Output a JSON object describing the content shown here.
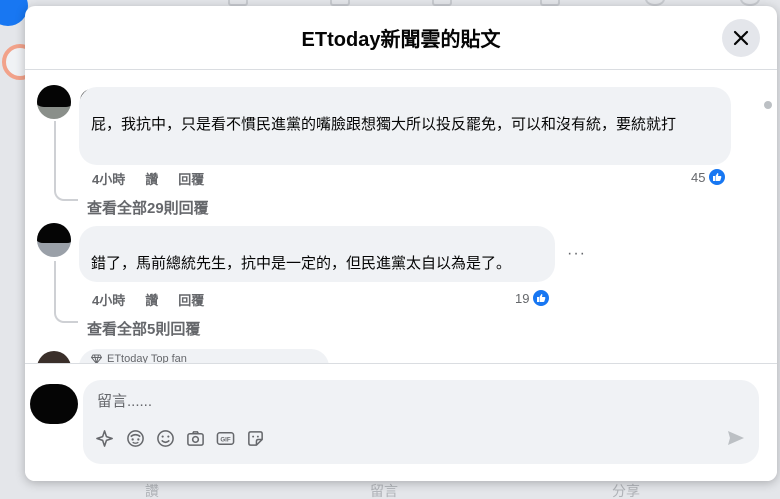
{
  "dialog": {
    "title": "ETtoday新聞雲的貼文",
    "close_label": "×"
  },
  "comments": [
    {
      "text": "屁，我抗中，只是看不慣民進黨的嘴臉跟想獨大所以投反罷免，可以和沒有統，要統就打",
      "time": "4小時",
      "like_action": "讚",
      "reply_action": "回覆",
      "reaction_count": "45",
      "view_replies": "查看全部29則回覆"
    },
    {
      "text": "錯了，馬前總統先生，抗中是一定的，但民進黨太自以為是了。",
      "time": "4小時",
      "like_action": "讚",
      "reply_action": "回覆",
      "reaction_count": "19",
      "view_replies": "查看全部5則回覆",
      "more": "···"
    },
    {
      "badge": "ETtoday Top fan"
    }
  ],
  "composer": {
    "placeholder": "留言......"
  },
  "background": {
    "like": "讚",
    "comment": "留言",
    "share": "分享"
  },
  "colors": {
    "accent": "#1877f2",
    "bubble": "#f0f2f5",
    "secondary_text": "#65676b"
  }
}
